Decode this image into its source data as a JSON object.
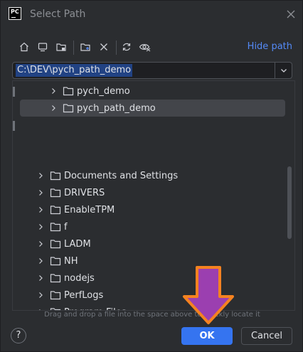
{
  "window": {
    "title": "Select Path",
    "app_logo_text": "PC"
  },
  "toolbar": {
    "icons": [
      "home-icon",
      "desktop-icon",
      "project-folder-icon",
      "new-folder-icon",
      "delete-icon",
      "refresh-icon",
      "show-hidden-icon"
    ],
    "hide_path_label": "Hide path"
  },
  "path": {
    "value": "C:\\DEV\\pych_path_demo"
  },
  "tree": {
    "items": [
      {
        "label": "pych_demo",
        "level": 2,
        "selected": false
      },
      {
        "label": "pych_path_demo",
        "level": 2,
        "selected": true
      },
      {
        "label": "Documents and Settings",
        "level": 1,
        "selected": false
      },
      {
        "label": "DRIVERS",
        "level": 1,
        "selected": false
      },
      {
        "label": "EnableTPM",
        "level": 1,
        "selected": false
      },
      {
        "label": "f",
        "level": 1,
        "selected": false
      },
      {
        "label": "LADM",
        "level": 1,
        "selected": false
      },
      {
        "label": "NH",
        "level": 1,
        "selected": false
      },
      {
        "label": "nodejs",
        "level": 1,
        "selected": false
      },
      {
        "label": "PerfLogs",
        "level": 1,
        "selected": false
      },
      {
        "label": "Program Files",
        "level": 1,
        "selected": false
      }
    ]
  },
  "hint": "Drag and drop a file into the space above to quickly locate it",
  "footer": {
    "help_label": "?",
    "ok_label": "OK",
    "cancel_label": "Cancel"
  },
  "colors": {
    "accent": "#3574f0",
    "link": "#548af7",
    "annotation_arrow": "#9b3fb0",
    "annotation_border": "#f58220"
  }
}
